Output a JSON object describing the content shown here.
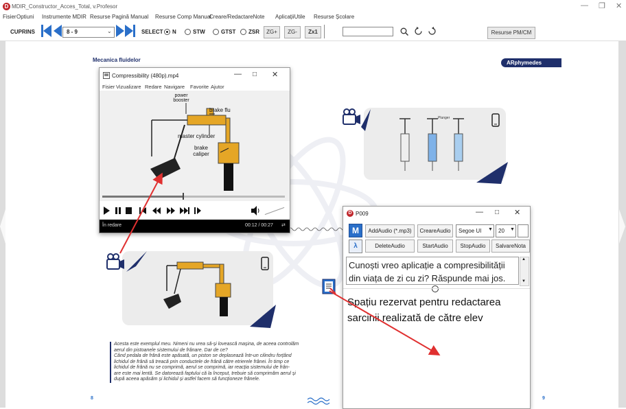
{
  "window": {
    "title": "MDIR_Constructor_Acces_Total, v.Profesor",
    "app_icon_letter": "D"
  },
  "menu": {
    "items": [
      "Fisier",
      "Optiuni",
      "Instrumente MDIR",
      "Resurse Pagină Manual",
      "Resurse Comp Manual",
      "Creare/RedactareNote",
      "AplicațiiUtile",
      "Resurse Școlare"
    ]
  },
  "toolbar": {
    "cuprins_label": "CUPRINS",
    "page_select_value": "8 - 9",
    "select_label": "SELECT",
    "radio_options": [
      {
        "label": "N",
        "selected": true
      },
      {
        "label": "STW",
        "selected": false
      },
      {
        "label": "GTST",
        "selected": false
      },
      {
        "label": "ZSR",
        "selected": false
      }
    ],
    "zoom_in_label": "ZG+",
    "zoom_out_label": "ZG-",
    "zoom_1_label": "Zx1",
    "search_value": "",
    "resurse_button_label": "Resurse PM/CM"
  },
  "page": {
    "left_header": "Mecanica fluidelor",
    "right_badge": "ARphymedes",
    "left_page_number": "8",
    "right_page_number": "9",
    "body_text": [
      "Acesta este exemplul meu. Nimeni nu vrea să-și lovească mașina, de aceea controlăm",
      "aerul din pistoanele sistemului de frânare. Dar de ce?",
      "Când pedala de frână este apăsată, un piston se deplasează într-un cilindru forțând",
      "lichidul de frână să treacă prin conductele de frână către etrierele frânei. În timp ce",
      "lichidul de frână nu se comprimă, aerul se comprimă, iar reacția sistemului de frân-",
      "are este mai lentă. Se datorează faptului că la început, trebuie să comprimăm aerul și",
      "după aceea apăsăm și lichidul și astfel facem să funcționeze frânele."
    ]
  },
  "video_player": {
    "title": "Compressibility (480p).mp4",
    "menu": [
      "Fisier",
      "Vizualizare",
      "Redare",
      "Navigare",
      "Favorite",
      "Ajutor"
    ],
    "diagram_labels": {
      "power_booster": "power booster",
      "brake_fluid": "brake flu",
      "master_cylinder": "master cylinder",
      "brake_caliper": "brake caliper"
    },
    "status": "În redare",
    "time": "00:12 / 00:27"
  },
  "syringe_labels": [
    "Plunger"
  ],
  "p009": {
    "title": "P009",
    "buttons_row1": [
      "AddAudio (*.mp3)",
      "CreareAudio"
    ],
    "font_name": "Segoe UI",
    "font_size": "20",
    "buttons_row2": [
      "DeleteAudio",
      "StartAudio",
      "StopAudio",
      "SalvareNota"
    ],
    "question": "Cunoști vreo aplicație a compresibilității din viața de zi cu zi? Răspunde mai jos.",
    "answer": "Spațiu rezervat pentru redactarea sarcinii realizată de către elev"
  },
  "colors": {
    "accent_blue": "#2a6fc9",
    "brand_navy": "#1f2f6b",
    "arrow_red": "#e03030",
    "app_red": "#c0262b"
  }
}
